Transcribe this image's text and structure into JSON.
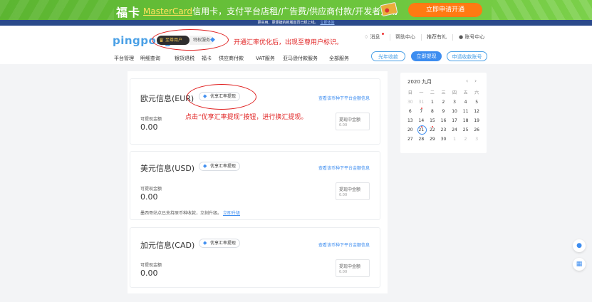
{
  "banner": {
    "title": "福卡",
    "brand": "MasterCard",
    "tagline": "信用卡，支付平台店租/广告费/供应商付款/开发者费用",
    "cta": "立即申请开通"
  },
  "notice": {
    "text": "更实用、更便捷的新版首页已经上线。",
    "link": "立即体验"
  },
  "header": {
    "logo": "pingpong",
    "vip_label": "至尊用户",
    "privilege_label": "特权服务",
    "messages": "消息",
    "help": "帮助中心",
    "referral": "推荐有礼",
    "account": "账号中心"
  },
  "annotations": {
    "header_note": "开通汇率优化后，出现至尊用户标识。",
    "card_note": "点击“优享汇率提现”按钮，进行换汇提现。"
  },
  "nav": {
    "items": [
      "平台管理",
      "明细查询",
      "银货退税",
      "福卡",
      "供应商付款",
      "VAT服务",
      "亚马逊付款服务",
      "全部服务"
    ],
    "buttons": {
      "charge": "光年收款",
      "withdraw": "立即提现",
      "apply": "申请收款账号"
    }
  },
  "cards": [
    {
      "title": "欧元信息(EUR)",
      "pref_btn": "优享汇率提现",
      "view_link": "查看该币种下平台金额信息",
      "amount_label": "可提现金额",
      "amount": "0.00",
      "withdrawing_label": "提现中金额",
      "withdrawing": "0.00"
    },
    {
      "title": "美元信息(USD)",
      "pref_btn": "优享汇率提现",
      "view_link": "查看该币种下平台金额信息",
      "amount_label": "可提现金额",
      "amount": "0.00",
      "withdrawing_label": "提现中金额",
      "withdrawing": "0.00",
      "note": "墨西哥站点已支持原币种收款，立刻升级。",
      "note_link": "立即升级"
    },
    {
      "title": "加元信息(CAD)",
      "pref_btn": "优享汇率提现",
      "view_link": "查看该币种下平台金额信息",
      "amount_label": "可提现金额",
      "amount": "0.00",
      "withdrawing_label": "提现中金额",
      "withdrawing": "0.00"
    }
  ],
  "calendar": {
    "title": "2020 九月",
    "weekdays": [
      "日",
      "一",
      "二",
      "三",
      "四",
      "五",
      "六"
    ],
    "weeks": [
      [
        "30",
        "31",
        "1",
        "2",
        "3",
        "4",
        "5"
      ],
      [
        "6",
        "7",
        "8",
        "9",
        "10",
        "11",
        "12"
      ],
      [
        "13",
        "14",
        "15",
        "16",
        "17",
        "18",
        "19"
      ],
      [
        "20",
        "21",
        "22",
        "23",
        "24",
        "25",
        "26"
      ],
      [
        "27",
        "28",
        "29",
        "30",
        "1",
        "2",
        "3"
      ]
    ]
  },
  "colors": {
    "accent": "#3d8df0",
    "annotation": "#e02020",
    "banner_green": "#67c23a"
  }
}
